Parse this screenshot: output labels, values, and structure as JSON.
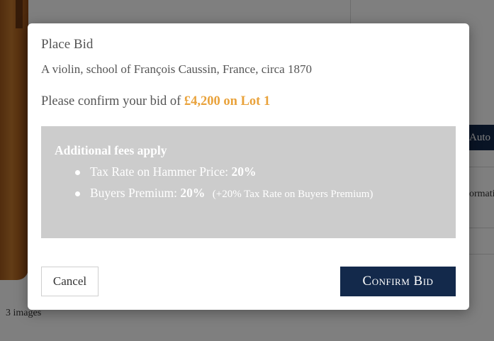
{
  "background": {
    "auto_button_label": "Auto",
    "info_text": "ormati",
    "images_count": "3 images"
  },
  "modal": {
    "title": "Place Bid",
    "lot_title": "A violin, school of François Caussin, France, circa 1870",
    "confirm_prefix": "Please confirm your bid of",
    "confirm_amount": "£4,200 on Lot 1",
    "fees": {
      "heading": "Additional fees apply",
      "items": [
        {
          "label": "Tax Rate on Hammer Price:",
          "value": "20%",
          "note": ""
        },
        {
          "label": "Buyers Premium:",
          "value": "20%",
          "note": "(+20% Tax Rate on Buyers Premium)"
        }
      ]
    },
    "cancel_label": "Cancel",
    "confirm_label": "Confirm Bid"
  },
  "colors": {
    "accent": "#e9a23b",
    "primary": "#13294b",
    "fees_bg": "#cccccc"
  }
}
